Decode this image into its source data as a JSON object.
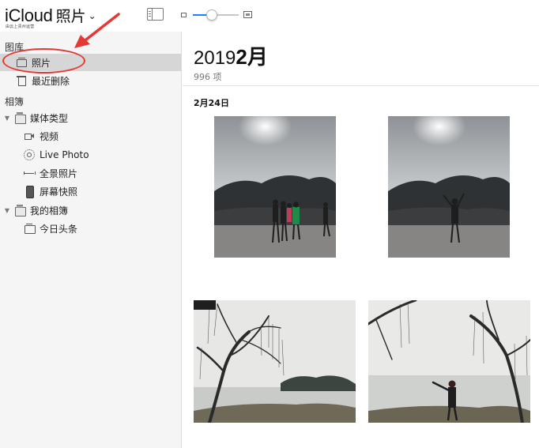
{
  "header": {
    "brand": "iCloud",
    "app_name": "照片",
    "subtitle": "由云上贵州运营"
  },
  "toolbar": {
    "zoom_level": 0.42
  },
  "sidebar": {
    "library_heading": "图库",
    "albums_heading": "相簿",
    "items": [
      {
        "label": "照片",
        "icon": "photos-icon"
      },
      {
        "label": "最近删除",
        "icon": "trash-icon"
      },
      {
        "label": "媒体类型",
        "icon": "stack-icon"
      },
      {
        "label": "视频",
        "icon": "video-icon"
      },
      {
        "label": "Live Photo",
        "icon": "live-photo-icon"
      },
      {
        "label": "全景照片",
        "icon": "panorama-icon"
      },
      {
        "label": "屏幕快照",
        "icon": "screenshot-icon"
      },
      {
        "label": "我的相簿",
        "icon": "stack-icon"
      },
      {
        "label": "今日头条",
        "icon": "album-icon"
      }
    ]
  },
  "main": {
    "year": "2019",
    "month": "2月",
    "count": "996 项",
    "date_label": "2月24日"
  },
  "colors": {
    "accent": "#1a82fb",
    "annotation": "#e53935",
    "selected_row": "#d6d6d6",
    "sidebar_bg": "#f5f5f6"
  }
}
